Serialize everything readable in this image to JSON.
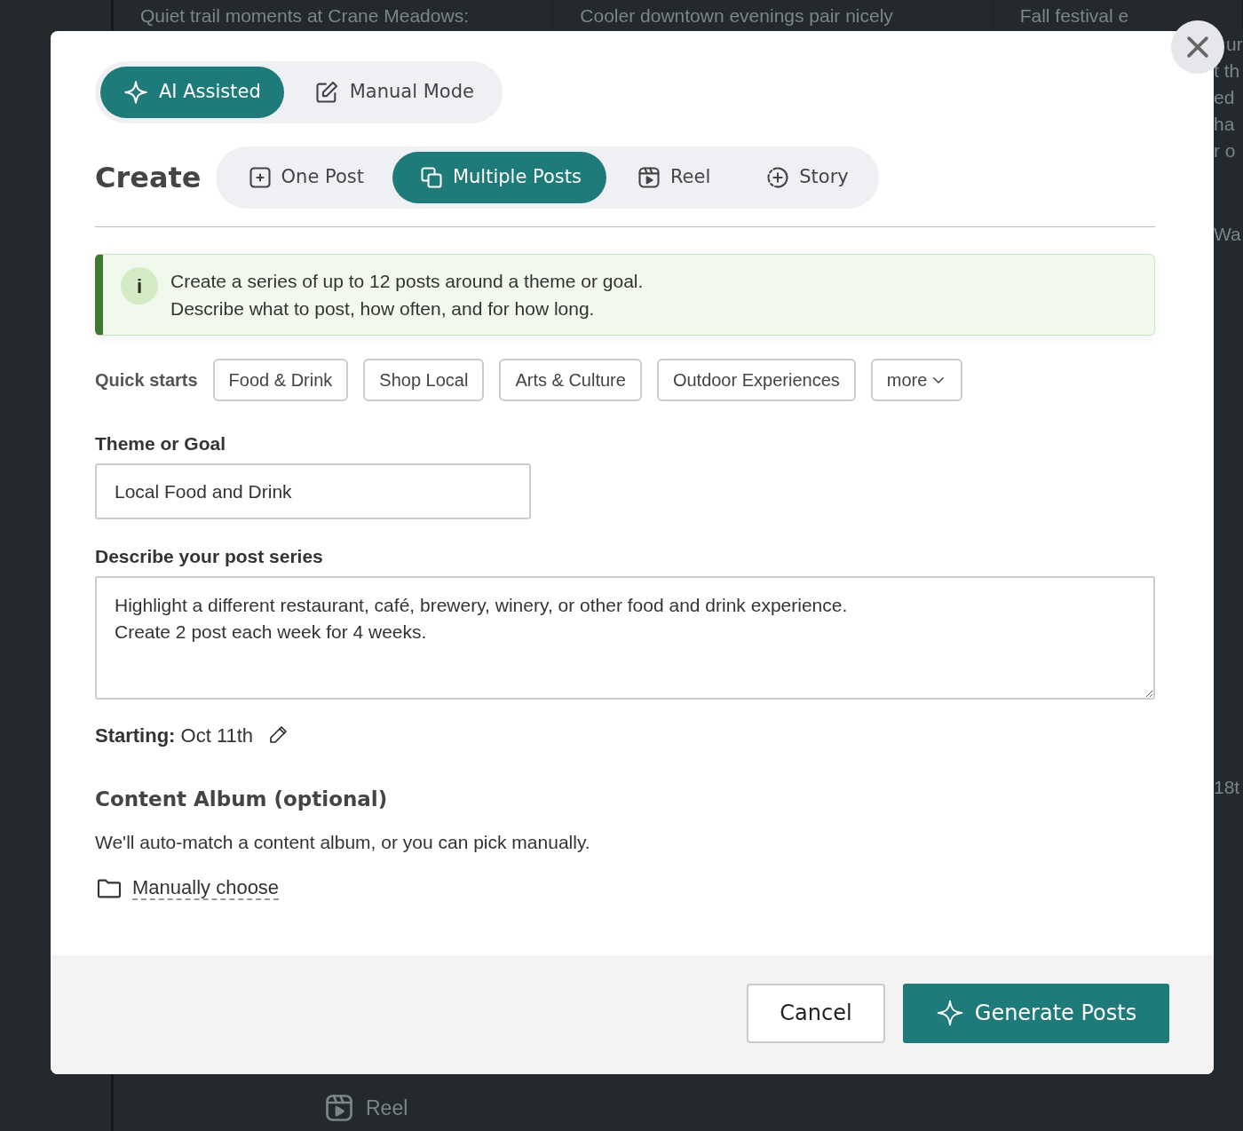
{
  "background": {
    "cards": [
      "Quiet trail moments at Crane Meadows:",
      "Cooler downtown evenings pair nicely",
      "Fall festival e"
    ],
    "side_lines": [
      "ur",
      "t th",
      "ed",
      "ha",
      "r o",
      "Wa",
      "18t"
    ],
    "bottom_item": {
      "label": "Reel"
    }
  },
  "modal": {
    "mode_tabs": [
      {
        "label": "AI Assisted",
        "selected": true
      },
      {
        "label": "Manual Mode",
        "selected": false
      }
    ],
    "create_title": "Create",
    "type_tabs": [
      {
        "label": "One Post",
        "selected": false
      },
      {
        "label": "Multiple Posts",
        "selected": true
      },
      {
        "label": "Reel",
        "selected": false
      },
      {
        "label": "Story",
        "selected": false
      }
    ],
    "info": {
      "icon_text": "i",
      "lines": [
        "Create a series of up to 12 posts around a theme or goal.",
        "Describe what to post, how often, and for how long."
      ]
    },
    "quick_starts": {
      "label": "Quick starts",
      "chips": [
        "Food & Drink",
        "Shop Local",
        "Arts & Culture",
        "Outdoor Experiences"
      ],
      "more": "more"
    },
    "theme": {
      "label": "Theme or Goal",
      "value": "Local Food and Drink"
    },
    "description": {
      "label": "Describe your post series",
      "value": "Highlight a different restaurant, café, brewery, winery, or other food and drink experience.\nCreate 2 post each week for 4 weeks."
    },
    "starting": {
      "label": "Starting:",
      "value": "Oct 11th"
    },
    "album": {
      "title": "Content Album (optional)",
      "text": "We'll auto-match a content album, or you can pick manually.",
      "link": "Manually choose"
    },
    "buttons": {
      "cancel": "Cancel",
      "generate": "Generate Posts"
    }
  }
}
